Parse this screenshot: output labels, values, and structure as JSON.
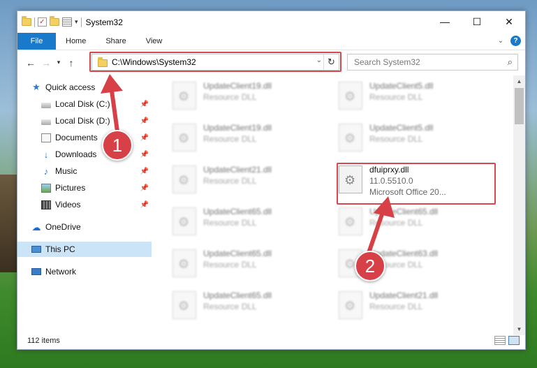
{
  "window": {
    "title": "System32"
  },
  "window_controls": {
    "minimize": "—",
    "maximize": "☐",
    "close": "✕"
  },
  "ribbon": {
    "file": "File",
    "tabs": [
      "Home",
      "Share",
      "View"
    ]
  },
  "navigation": {
    "address": "C:\\Windows\\System32",
    "search_placeholder": "Search System32"
  },
  "sidebar": {
    "items": [
      {
        "label": "Quick access",
        "icon": "star-icon"
      },
      {
        "label": "Local Disk (C:)",
        "icon": "drive-icon",
        "pinned": true
      },
      {
        "label": "Local Disk (D:)",
        "icon": "drive-icon",
        "pinned": true
      },
      {
        "label": "Documents",
        "icon": "documents-icon",
        "pinned": true
      },
      {
        "label": "Downloads",
        "icon": "downloads-icon",
        "pinned": true
      },
      {
        "label": "Music",
        "icon": "music-icon",
        "pinned": true
      },
      {
        "label": "Pictures",
        "icon": "pictures-icon",
        "pinned": true
      },
      {
        "label": "Videos",
        "icon": "videos-icon",
        "pinned": true
      },
      {
        "label": "OneDrive",
        "icon": "onedrive-icon"
      },
      {
        "label": "This PC",
        "icon": "this-pc-icon",
        "selected": true
      },
      {
        "label": "Network",
        "icon": "network-icon"
      }
    ]
  },
  "files": [
    {
      "name": "UpdateClient19.dll",
      "sub": "Resource DLL",
      "blurred": true
    },
    {
      "name": "UpdateClient5.dll",
      "sub": "Resource DLL",
      "blurred": true
    },
    {
      "name": "UpdateClient19.dll",
      "sub": "Resource DLL",
      "blurred": true
    },
    {
      "name": "UpdateClient5.dll",
      "sub": "Resource DLL",
      "blurred": true
    },
    {
      "name": "UpdateClient21.dll",
      "sub": "Resource DLL",
      "blurred": true
    },
    {
      "name": "dfuiprxy.dll",
      "sub": "11.0.5510.0",
      "sub2": "Microsoft Office 20...",
      "blurred": false
    },
    {
      "name": "UpdateClient65.dll",
      "sub": "Resource DLL",
      "blurred": true
    },
    {
      "name": "UpdateClient65.dll",
      "sub": "Resource DLL",
      "blurred": true
    },
    {
      "name": "UpdateClient65.dll",
      "sub": "Resource DLL",
      "blurred": true
    },
    {
      "name": "UpdateClient63.dll",
      "sub": "Resource DLL",
      "blurred": true
    },
    {
      "name": "UpdateClient65.dll",
      "sub": "Resource DLL",
      "blurred": true
    },
    {
      "name": "UpdateClient21.dll",
      "sub": "Resource DLL",
      "blurred": true
    }
  ],
  "status": {
    "item_count": "112 items"
  },
  "annotations": {
    "step1": "1",
    "step2": "2",
    "accent": "#d9474b"
  }
}
